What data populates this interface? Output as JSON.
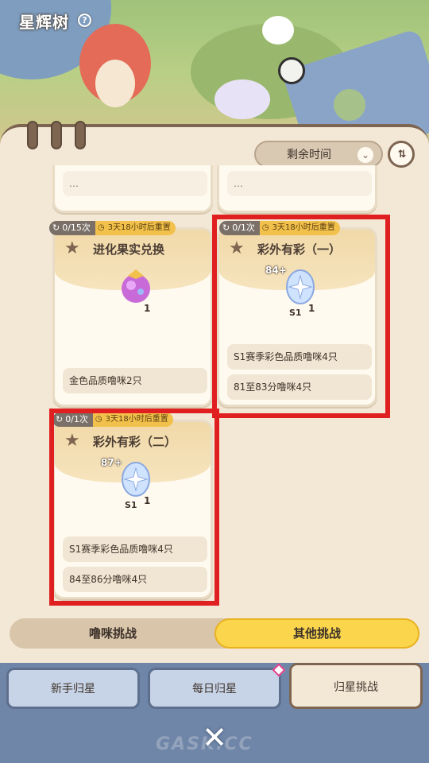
{
  "app": {
    "title": "星辉树",
    "help": "?"
  },
  "toolbar": {
    "sort_label": "剩余时间"
  },
  "cards": [
    {
      "title": "进化果实兑换",
      "tag_count": "0/15次",
      "tag_time": "3天18小时后重置",
      "reward_qty": "1",
      "reward_badge": "",
      "conditions": [
        "金色品质噜咪2只"
      ]
    },
    {
      "title": "彩外有彩（一）",
      "tag_count": "0/1次",
      "tag_time": "3天18小时后重置",
      "reward_qty": "1",
      "reward_badge": "84+",
      "reward_season": "S1",
      "conditions": [
        "S1赛季彩色品质噜咪4只",
        "81至83分噜咪4只"
      ]
    },
    {
      "title": "彩外有彩（二）",
      "tag_count": "0/1次",
      "tag_time": "3天18小时后重置",
      "reward_qty": "1",
      "reward_badge": "87+",
      "reward_season": "S1",
      "conditions": [
        "S1赛季彩色品质噜咪4只",
        "84至86分噜咪4只"
      ]
    }
  ],
  "segment": {
    "left": "噜咪挑战",
    "right": "其他挑战"
  },
  "bottom_tabs": [
    "新手归星",
    "每日归星",
    "归星挑战"
  ],
  "watermark": "GASK.CC",
  "colors": {
    "highlight": "#e02020",
    "accent": "#fbd64c",
    "panel": "#f3e8d6"
  }
}
